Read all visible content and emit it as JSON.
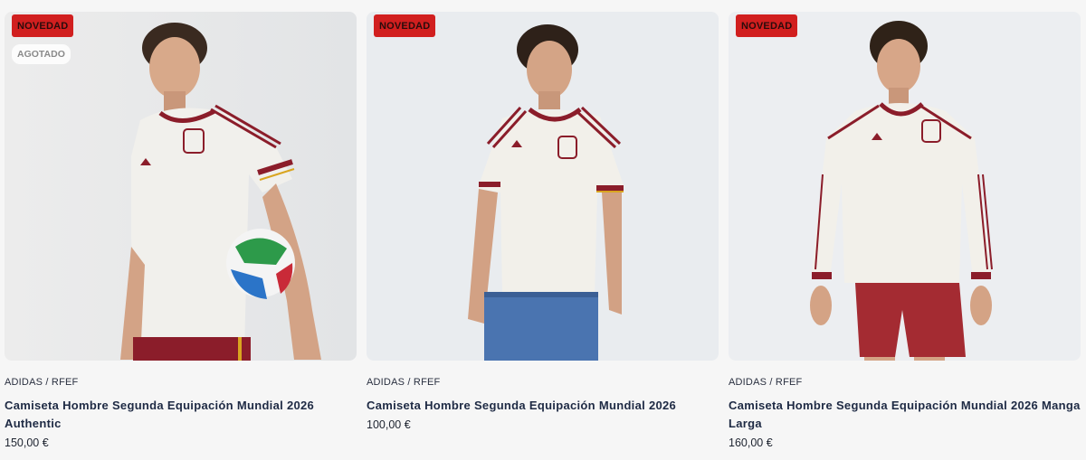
{
  "products": [
    {
      "badges": {
        "new": "NOVEDAD",
        "soldout": "AGOTADO"
      },
      "brand": "ADIDAS / RFEF",
      "title": "Camiseta Hombre Segunda Equipación Mundial 2026 Authentic",
      "price": "150,00 €"
    },
    {
      "badges": {
        "new": "NOVEDAD"
      },
      "brand": "ADIDAS / RFEF",
      "title": "Camiseta Hombre Segunda Equipación Mundial 2026",
      "price": "100,00 €"
    },
    {
      "badges": {
        "new": "NOVEDAD"
      },
      "brand": "ADIDAS / RFEF",
      "title": "Camiseta Hombre Segunda Equipación Mundial 2026 Manga Larga",
      "price": "160,00 €"
    }
  ],
  "colors": {
    "badge_red": "#d11f1f",
    "shirt_white": "#f3f1ec",
    "trim_maroon": "#8b1d2a",
    "trim_gold": "#d9a520",
    "title_navy": "#1e2a44"
  }
}
